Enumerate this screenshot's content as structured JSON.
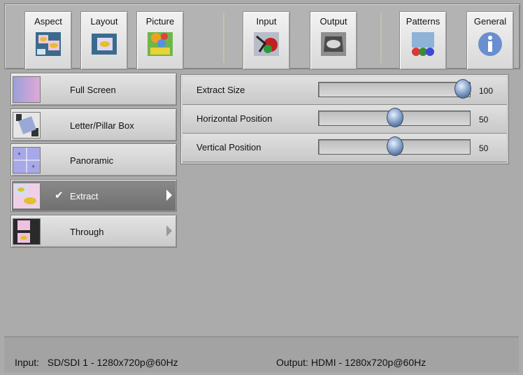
{
  "toolbar": {
    "buttons": [
      {
        "label": "Aspect",
        "icon": "aspect-icon"
      },
      {
        "label": "Layout",
        "icon": "layout-icon"
      },
      {
        "label": "Picture",
        "icon": "picture-icon"
      },
      {
        "label": "Input",
        "icon": "input-icon"
      },
      {
        "label": "Output",
        "icon": "output-icon"
      },
      {
        "label": "Patterns",
        "icon": "patterns-icon"
      },
      {
        "label": "General",
        "icon": "info-icon"
      }
    ]
  },
  "menu": {
    "items": [
      {
        "label": "Full Screen",
        "selected": false
      },
      {
        "label": "Letter/Pillar Box",
        "selected": false
      },
      {
        "label": "Panoramic",
        "selected": false
      },
      {
        "label": "Extract",
        "selected": true,
        "checked": true,
        "has_submenu": true
      },
      {
        "label": "Through",
        "selected": false,
        "has_submenu": true
      }
    ]
  },
  "settings": {
    "rows": [
      {
        "label": "Extract Size",
        "value": "100",
        "level": 100,
        "min": 0,
        "max": 100
      },
      {
        "label": "Horizontal Position",
        "value": "50",
        "level": 50,
        "min": 0,
        "max": 100
      },
      {
        "label": "Vertical Position",
        "value": "50",
        "level": 50,
        "min": 0,
        "max": 100
      }
    ]
  },
  "status": {
    "input_label": "Input:",
    "input_value": "SD/SDI 1 - 1280x720p@60Hz",
    "output_label": "Output:",
    "output_value": "HDMI - 1280x720p@60Hz"
  },
  "colors": {
    "background": "#ababab",
    "selected": "#7a7a7a",
    "knob": "#6f8fbf"
  }
}
